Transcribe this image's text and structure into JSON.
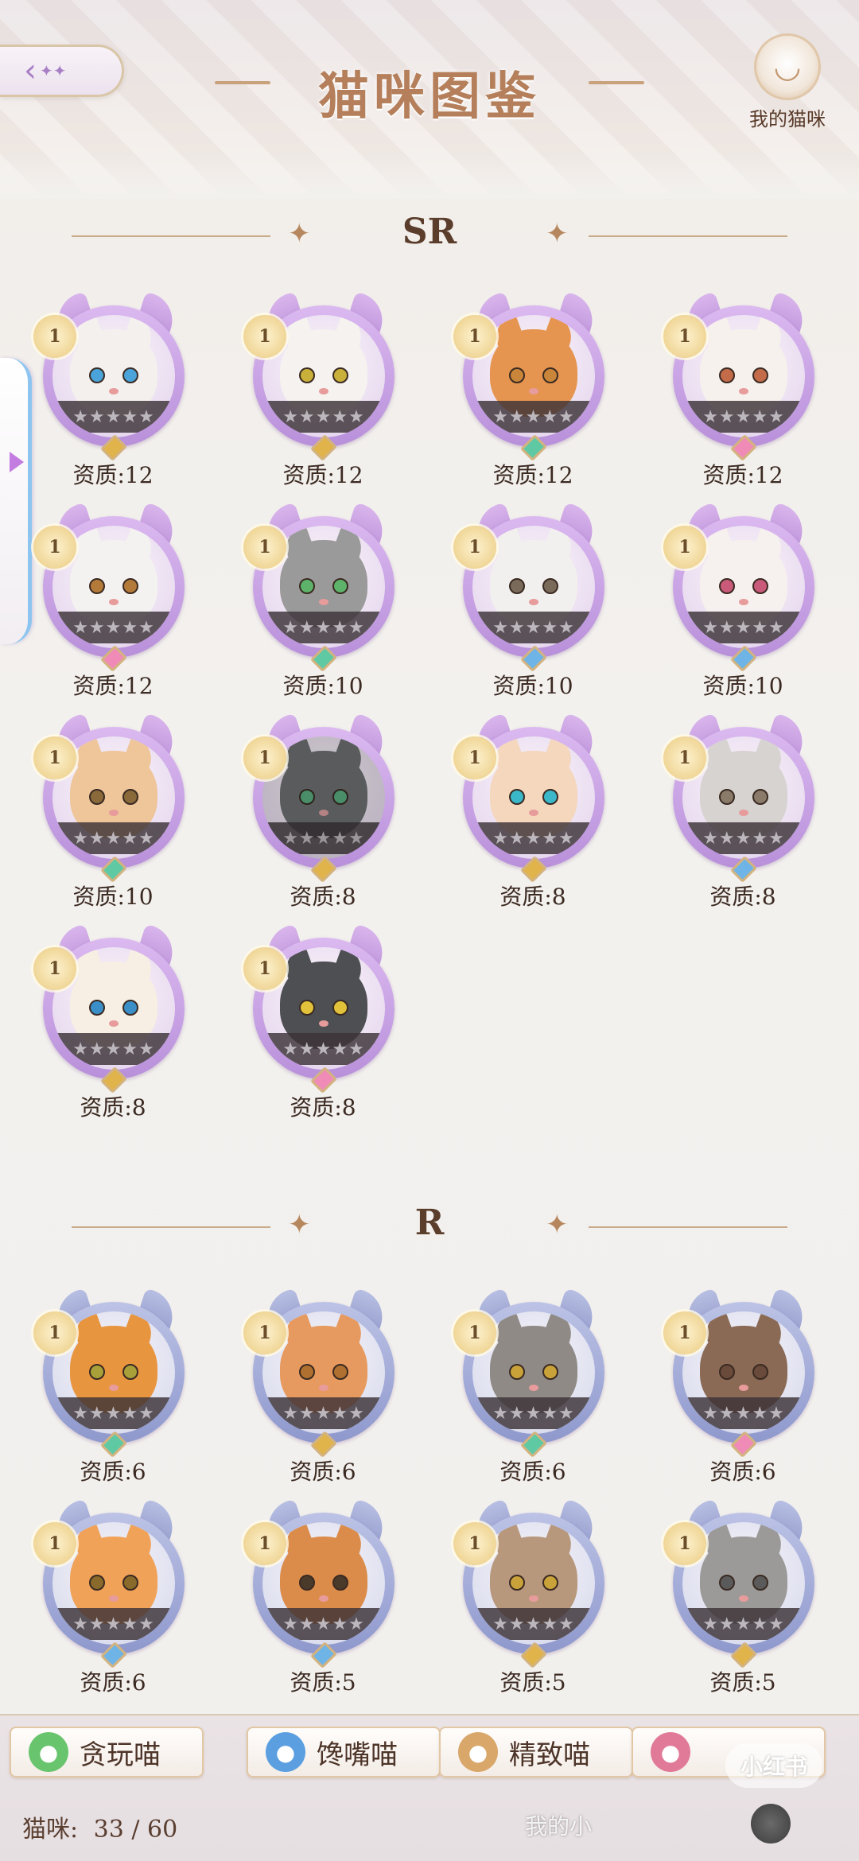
{
  "header": {
    "title": "猫咪图鉴",
    "my_cats_label": "我的猫咪",
    "back_icon": "double-chevron-left-icon",
    "my_cats_icon": "cat-head-icon"
  },
  "sections": {
    "sr": {
      "label": "SR"
    },
    "r": {
      "label": "R"
    }
  },
  "sr_cats": [
    {
      "level": "1",
      "quality": "资质:12",
      "fur": "#f3f0ee",
      "eye": "#4aa3d9",
      "gem": "#e0b34b"
    },
    {
      "level": "1",
      "quality": "资质:12",
      "fur": "#f5f2ef",
      "eye": "#c9b03a",
      "gem": "#e0b34b"
    },
    {
      "level": "1",
      "quality": "资质:12",
      "fur": "#e59550",
      "eye": "#c9863a",
      "gem": "#5fc9a4"
    },
    {
      "level": "1",
      "quality": "资质:12",
      "fur": "#f6f1ec",
      "eye": "#c46c4a",
      "gem": "#f08bb8"
    },
    {
      "level": "1",
      "quality": "资质:12",
      "fur": "#f4f2f0",
      "eye": "#b47a3a",
      "gem": "#f08bb8"
    },
    {
      "level": "1",
      "quality": "资质:10",
      "fur": "#9a9a9a",
      "eye": "#5db36a",
      "gem": "#5fc9a4"
    },
    {
      "level": "1",
      "quality": "资质:10",
      "fur": "#f2f0ee",
      "eye": "#7a6a5a",
      "gem": "#6fb4e6"
    },
    {
      "level": "1",
      "quality": "资质:10",
      "fur": "#f6f0ee",
      "eye": "#c95a7a",
      "gem": "#6fb4e6"
    },
    {
      "level": "1",
      "quality": "资质:10",
      "fur": "#efc59a",
      "eye": "#8a6a3a",
      "gem": "#5fc9a4"
    },
    {
      "level": "1",
      "quality": "资质:8",
      "fur": "#6c6f72",
      "eye": "#4ab37a",
      "gem": "#e0b34b"
    },
    {
      "level": "1",
      "quality": "资质:8",
      "fur": "#f4d7bd",
      "eye": "#3ab8c9",
      "gem": "#e0b34b"
    },
    {
      "level": "1",
      "quality": "资质:8",
      "fur": "#d6d3d0",
      "eye": "#8a7a6a",
      "gem": "#6fb4e6"
    },
    {
      "level": "1",
      "quality": "资质:8",
      "fur": "#f7efe3",
      "eye": "#3a8fc9",
      "gem": "#e0b34b"
    },
    {
      "level": "1",
      "quality": "资质:8",
      "fur": "#4d4f52",
      "eye": "#e2c23a",
      "gem": "#f08bb8"
    }
  ],
  "r_cats": [
    {
      "level": "1",
      "quality": "资质:6",
      "fur": "#e8953f",
      "eye": "#a9a03a",
      "gem": "#5fc9a4"
    },
    {
      "level": "1",
      "quality": "资质:6",
      "fur": "#e79a5f",
      "eye": "#b0702f",
      "gem": "#e0b34b"
    },
    {
      "level": "1",
      "quality": "资质:6",
      "fur": "#8f8a85",
      "eye": "#c9a23a",
      "gem": "#5fc9a4"
    },
    {
      "level": "1",
      "quality": "资质:6",
      "fur": "#8a6a55",
      "eye": "#6a4a3a",
      "gem": "#f08bb8"
    },
    {
      "level": "1",
      "quality": "资质:6",
      "fur": "#f0a258",
      "eye": "#8a6a2a",
      "gem": "#6fb4e6"
    },
    {
      "level": "1",
      "quality": "资质:5",
      "fur": "#db8c4a",
      "eye": "#4a3a2a",
      "gem": "#6fb4e6"
    },
    {
      "level": "1",
      "quality": "资质:5",
      "fur": "#b8987c",
      "eye": "#c9a23a",
      "gem": "#e0b34b"
    },
    {
      "level": "1",
      "quality": "资质:5",
      "fur": "#9c9a98",
      "eye": "#5a5a5a",
      "gem": "#e0b34b"
    }
  ],
  "stars_text": "★★★★★",
  "filters": [
    {
      "label": "贪玩喵",
      "icon": "playful-cat-icon",
      "color": "#69c46e"
    },
    {
      "label": "馋嘴喵",
      "icon": "greedy-cat-icon",
      "color": "#5b9fe0"
    },
    {
      "label": "精致喵",
      "icon": "elegant-cat-icon",
      "color": "#d9a769"
    },
    {
      "label": "",
      "icon": "cute-cat-icon",
      "color": "#e07a98"
    }
  ],
  "footer": {
    "count_label": "猫咪:",
    "count_value": "33 / 60",
    "watermark": "我的小",
    "watermark_logo": "小红书"
  }
}
